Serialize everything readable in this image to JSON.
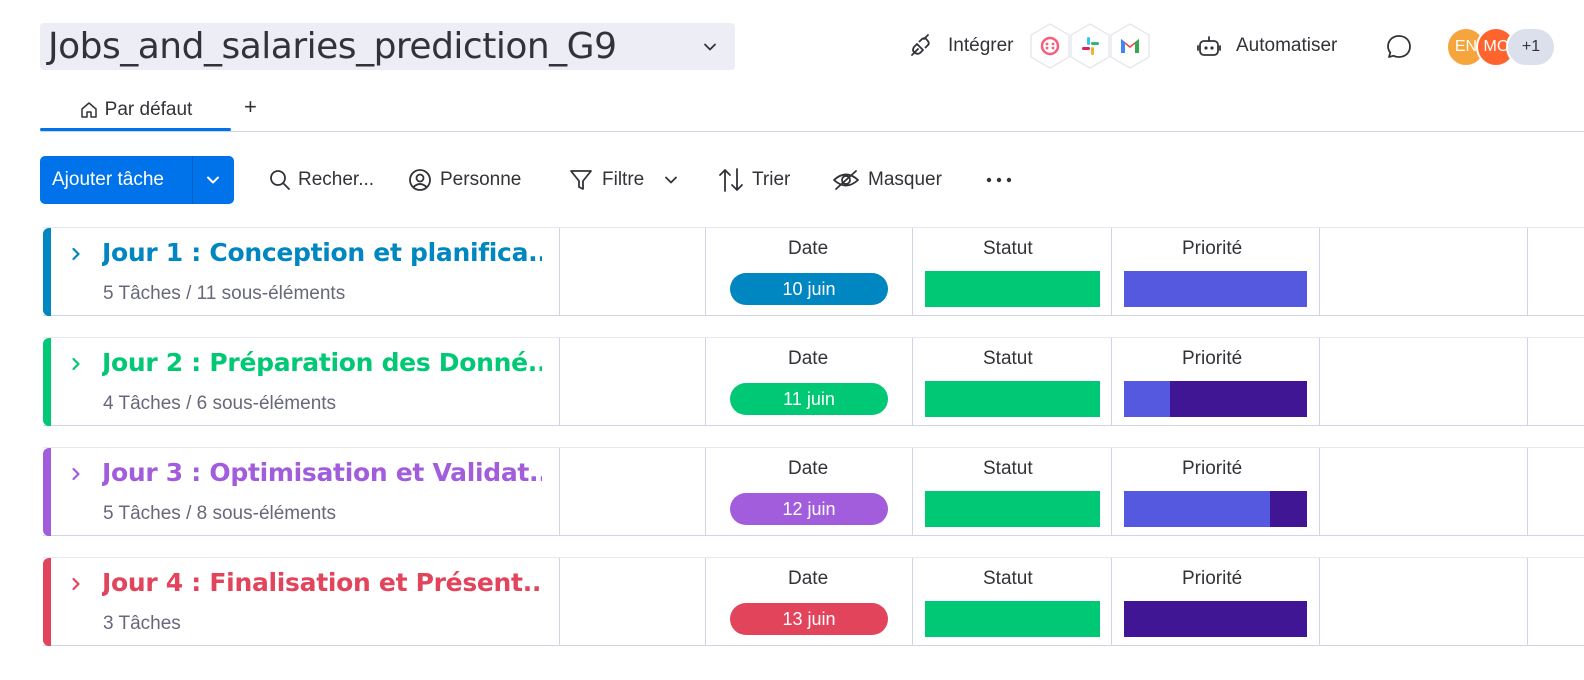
{
  "board": {
    "title": "Jobs_and_salaries_prediction_G9"
  },
  "header": {
    "integrate_label": "Intégrer",
    "integration_icons": [
      "monday-app-icon",
      "slack-icon",
      "gmail-icon"
    ],
    "automate_label": "Automatiser",
    "avatars": [
      {
        "initials": "EN",
        "color": "#f5a53b"
      },
      {
        "initials": "MC",
        "color": "#ff642e"
      }
    ],
    "more_members": "+1"
  },
  "tabs": {
    "default_label": "Par défaut",
    "add_label": "+"
  },
  "toolbar": {
    "add_task_label": "Ajouter tâche",
    "search_label": "Recher...",
    "person_label": "Personne",
    "filter_label": "Filtre",
    "sort_label": "Trier",
    "hide_label": "Masquer"
  },
  "colors": {
    "accent": "#0073ea",
    "status_done": "#00c875",
    "priority_medium": "#5559df",
    "priority_high": "#401694"
  },
  "columns": {
    "date": "Date",
    "status": "Statut",
    "priority": "Priorité"
  },
  "groups": [
    {
      "name": "Jour 1 : Conception et planifica...",
      "summary": "5 Tâches / 11 sous-éléments",
      "color": "#0086c0",
      "date": "10 juin",
      "status_done_fraction": 1.0,
      "priority_high_fraction": 0.0
    },
    {
      "name": "Jour 2 : Préparation des Donné...",
      "summary": "4 Tâches / 6 sous-éléments",
      "color": "#00c875",
      "date": "11 juin",
      "status_done_fraction": 1.0,
      "priority_high_fraction": 0.75
    },
    {
      "name": "Jour 3 : Optimisation et Validat...",
      "summary": "5 Tâches / 8 sous-éléments",
      "color": "#a25ddc",
      "date": "12 juin",
      "status_done_fraction": 1.0,
      "priority_high_fraction": 0.2
    },
    {
      "name": "Jour 4 : Finalisation et Présent...",
      "summary": "3 Tâches",
      "color": "#e2445c",
      "date": "13 juin",
      "status_done_fraction": 1.0,
      "priority_high_fraction": 1.0
    }
  ]
}
